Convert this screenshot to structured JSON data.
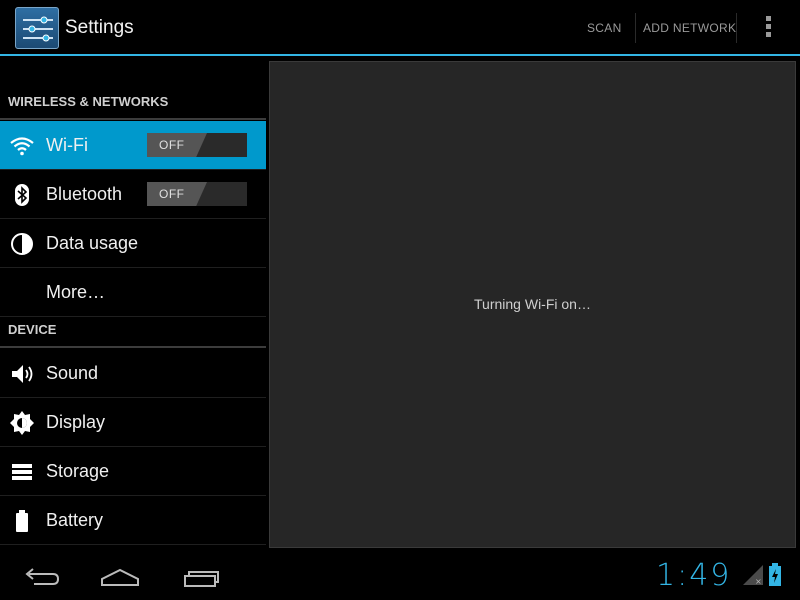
{
  "action_bar": {
    "title": "Settings",
    "scan_label": "SCAN",
    "add_network_label": "ADD NETWORK",
    "app_icon": "settings-sliders-icon",
    "overflow_icon": "overflow-menu-icon"
  },
  "sidebar": {
    "sections": [
      {
        "header": "WIRELESS & NETWORKS"
      },
      {
        "header": "DEVICE"
      }
    ],
    "items": [
      {
        "label": "Wi-Fi",
        "icon": "wifi-icon",
        "toggle": "OFF",
        "selected": true
      },
      {
        "label": "Bluetooth",
        "icon": "bluetooth-icon",
        "toggle": "OFF",
        "selected": false
      },
      {
        "label": "Data usage",
        "icon": "data-usage-icon",
        "selected": false
      },
      {
        "label": "More…",
        "icon": "",
        "selected": false
      },
      {
        "label": "Sound",
        "icon": "speaker-icon",
        "selected": false
      },
      {
        "label": "Display",
        "icon": "brightness-icon",
        "selected": false
      },
      {
        "label": "Storage",
        "icon": "storage-icon",
        "selected": false
      },
      {
        "label": "Battery",
        "icon": "battery-icon",
        "selected": false
      }
    ]
  },
  "main": {
    "status_message": "Turning Wi-Fi on…"
  },
  "system_bar": {
    "time": "1:49",
    "nav_icons": [
      "back-icon",
      "home-icon",
      "recent-apps-icon"
    ],
    "status_icons": [
      "signal-icon",
      "battery-charging-icon"
    ]
  },
  "colors": {
    "accent": "#33b5e5",
    "selected_bg": "#0099cc",
    "background": "#000000",
    "content_bg": "#262626"
  }
}
